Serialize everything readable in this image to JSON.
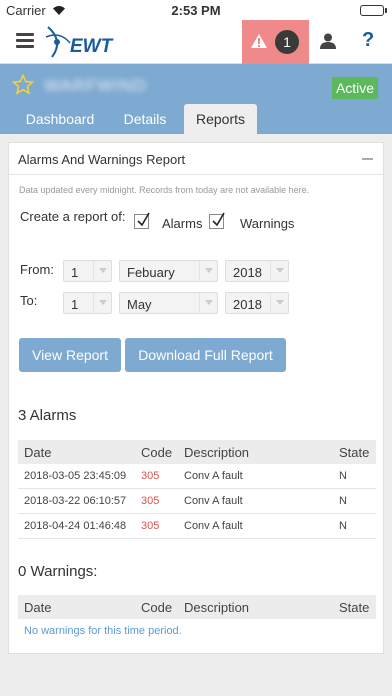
{
  "status_bar": {
    "carrier": "Carrier",
    "time": "2:53 PM"
  },
  "header": {
    "alert_count": "1",
    "help": "?"
  },
  "asset": {
    "name": "WARFWIND",
    "status": "Active"
  },
  "tabs": [
    {
      "label": "Dashboard"
    },
    {
      "label": "Details"
    },
    {
      "label": "Reports"
    }
  ],
  "report": {
    "title": "Alarms And Warnings Report",
    "notice": "Data updated every midnight. Records from today are not available here.",
    "create_label": "Create a report of:",
    "alarms_checked": true,
    "warnings_checked": true,
    "alarms_label": "Alarms",
    "warnings_label": "Warnings",
    "from_label": "From:",
    "to_label": "To:",
    "from": {
      "day": "1",
      "month": "Febuary",
      "year": "2018"
    },
    "to": {
      "day": "1",
      "month": "May",
      "year": "2018"
    },
    "view_button": "View Report",
    "download_button": "Download Full Report"
  },
  "alarms": {
    "heading": "3 Alarms",
    "columns": [
      "Date",
      "Code",
      "Description",
      "State"
    ],
    "rows": [
      {
        "date": "2018-03-05 23:45:09",
        "code": "305",
        "description": "Conv A fault",
        "state": "N"
      },
      {
        "date": "2018-03-22 06:10:57",
        "code": "305",
        "description": "Conv A fault",
        "state": "N"
      },
      {
        "date": "2018-04-24 01:46:48",
        "code": "305",
        "description": "Conv A fault",
        "state": "N"
      }
    ]
  },
  "warnings": {
    "heading": "0 Warnings:",
    "columns": [
      "Date",
      "Code",
      "Description",
      "State"
    ],
    "empty_message": "No warnings for this time period."
  },
  "colors": {
    "accent": "#7ea9d0",
    "alert": "#f08a8a",
    "active": "#5cb85c",
    "code": "#d9534f"
  }
}
